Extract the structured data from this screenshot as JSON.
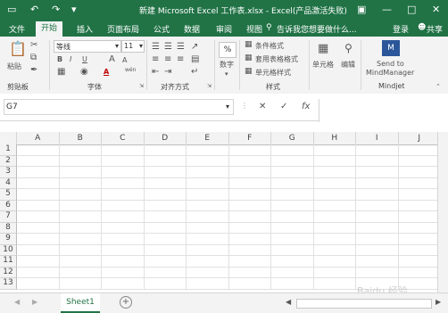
{
  "window": {
    "title": "新建 Microsoft Excel 工作表.xlsx - Excel(产品激活失败)"
  },
  "quick_access": {
    "save_icon": "save-icon",
    "undo_icon": "undo-icon",
    "redo_icon": "redo-icon"
  },
  "account": {
    "login_label": "登录",
    "share_label": "共享"
  },
  "ribbon_tabs": [
    {
      "label": "文件"
    },
    {
      "label": "开始"
    },
    {
      "label": "插入"
    },
    {
      "label": "页面布局"
    },
    {
      "label": "公式"
    },
    {
      "label": "数据"
    },
    {
      "label": "审阅"
    },
    {
      "label": "视图"
    }
  ],
  "tell_me": "告诉我您想要做什么...",
  "clipboard": {
    "paste_label": "粘贴",
    "group_label": "剪贴板"
  },
  "font": {
    "name": "等线",
    "size": "11",
    "bold": "B",
    "italic": "I",
    "underline": "U",
    "grow": "A",
    "shrink": "A",
    "font_color": "A",
    "wen": "wén",
    "group_label": "字体"
  },
  "alignment": {
    "group_label": "对齐方式"
  },
  "number": {
    "format_label": "数字",
    "percent": "%"
  },
  "styles": {
    "conditional_format": "条件格式",
    "table_format": "套用表格格式",
    "cell_style": "单元格样式",
    "group_label": "样式"
  },
  "cells": {
    "label": "单元格"
  },
  "editing": {
    "label": "编辑"
  },
  "mindjet": {
    "send_label": "Send to",
    "target_label": "MindManager",
    "group_label": "Mindjet"
  },
  "formula_bar": {
    "name_box": "G7",
    "cancel": "✕",
    "enter": "✓",
    "fx": "fx",
    "value": ""
  },
  "columns": [
    "A",
    "B",
    "C",
    "D",
    "E",
    "F",
    "G",
    "H",
    "I",
    "J"
  ],
  "rows": [
    "1",
    "2",
    "3",
    "4",
    "5",
    "6",
    "7",
    "8",
    "9",
    "10",
    "11",
    "12",
    "13"
  ],
  "sheet": {
    "tab_label": "Sheet1"
  },
  "watermark": "Baidu 经验"
}
